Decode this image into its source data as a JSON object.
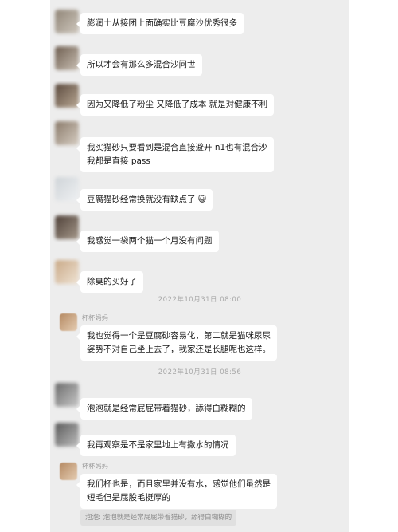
{
  "messages": [
    {
      "text": "膨润土从接团上面确实比豆腐沙优秀很多",
      "colors": [
        "#8f8476",
        "#cfc8be"
      ]
    },
    {
      "text": "所以才会有那么多混合沙问世",
      "colors": [
        "#6e5e50",
        "#c9bfb3"
      ]
    },
    {
      "text": "因为又降低了粉尘 又降低了成本  就是对健康不利",
      "colors": [
        "#5b4a3e",
        "#b9a894"
      ]
    },
    {
      "text": "我买猫砂只要看到是混合直接避开 n1也有混合沙\n我都是直接 pass",
      "colors": [
        "#8a7a6a",
        "#d6cdc2"
      ]
    },
    {
      "text": "豆腐猫砂经常换就没有缺点了",
      "emoji": "😺",
      "colors": [
        "#cfd4d8",
        "#eef0f2"
      ]
    },
    {
      "text": "我感觉一袋两个猫一个月没有问题",
      "colors": [
        "#4e4038",
        "#a5988a"
      ]
    },
    {
      "text": "除臭的买好了",
      "colors": [
        "#c9a987",
        "#efe3d4"
      ]
    }
  ],
  "timestamps": [
    "2022年10月31日 08:00",
    "2022年10月31日 08:56"
  ],
  "sender_name": "杯杯妈妈",
  "messages2": [
    {
      "text": "我也觉得一个是豆腐砂容易化，第二就是猫咪尿尿\n姿势不对自己坐上去了，我家还是长腿呢也这样。"
    }
  ],
  "messages3": [
    {
      "text": "泡泡就是经常屁屁带着猫砂，舔得白糊糊的",
      "colors": [
        "#6b6b6b",
        "#c8c8c8"
      ]
    },
    {
      "text": "我再观察是不是家里地上有撒水的情况",
      "colors": [
        "#5a5a5a",
        "#bdbdbd"
      ]
    }
  ],
  "sender_name2": "杯杯妈妈",
  "messages4": [
    {
      "text": "我们杯也是，而且家里并没有水，感觉他们虽然是\n短毛但是屁股毛挺厚的"
    }
  ],
  "quote": "泡泡: 泡泡就是经常屁屁带着猫砂，舔得白糊糊的"
}
